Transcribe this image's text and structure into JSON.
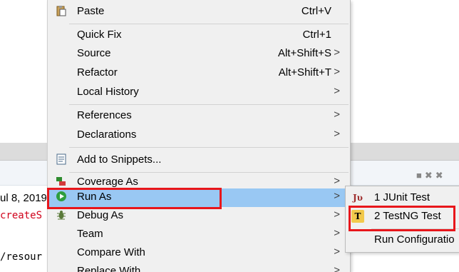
{
  "context_menu": {
    "items": [
      {
        "label": "Paste",
        "shortcut": "Ctrl+V",
        "icon": "clipboard-icon"
      },
      {
        "label": "Quick Fix",
        "shortcut": "Ctrl+1"
      },
      {
        "label": "Source",
        "shortcut": "Alt+Shift+S",
        "arrow": ">"
      },
      {
        "label": "Refactor",
        "shortcut": "Alt+Shift+T",
        "arrow": ">"
      },
      {
        "label": "Local History",
        "arrow": ">"
      },
      {
        "label": "References",
        "arrow": ">"
      },
      {
        "label": "Declarations",
        "arrow": ">"
      },
      {
        "label": "Add to Snippets...",
        "icon": "snippet-icon"
      },
      {
        "label": "Coverage As",
        "arrow": ">",
        "icon": "coverage-icon"
      },
      {
        "label": "Run As",
        "arrow": ">",
        "icon": "run-icon",
        "selected": true
      },
      {
        "label": "Debug As",
        "arrow": ">",
        "icon": "debug-icon"
      },
      {
        "label": "Team",
        "arrow": ">"
      },
      {
        "label": "Compare With",
        "arrow": ">"
      },
      {
        "label": "Replace With",
        "arrow": ">"
      }
    ]
  },
  "run_as_submenu": {
    "items": [
      {
        "label": "1 JUnit Test",
        "icon": "junit-icon",
        "icon_text": "Jυ"
      },
      {
        "label": "2 TestNG Test",
        "icon": "testng-icon",
        "icon_text": "T"
      },
      {
        "label": "Run Configuratio"
      }
    ]
  },
  "background": {
    "date_fragment": "ul 8, 2019",
    "code_fragment": "createS",
    "path_fragment": "/resour"
  },
  "colors": {
    "menu_background": "#f0f0f0",
    "selection": "#99c8f3",
    "annotation_red": "#e8161b",
    "code_red": "#d0021b"
  }
}
